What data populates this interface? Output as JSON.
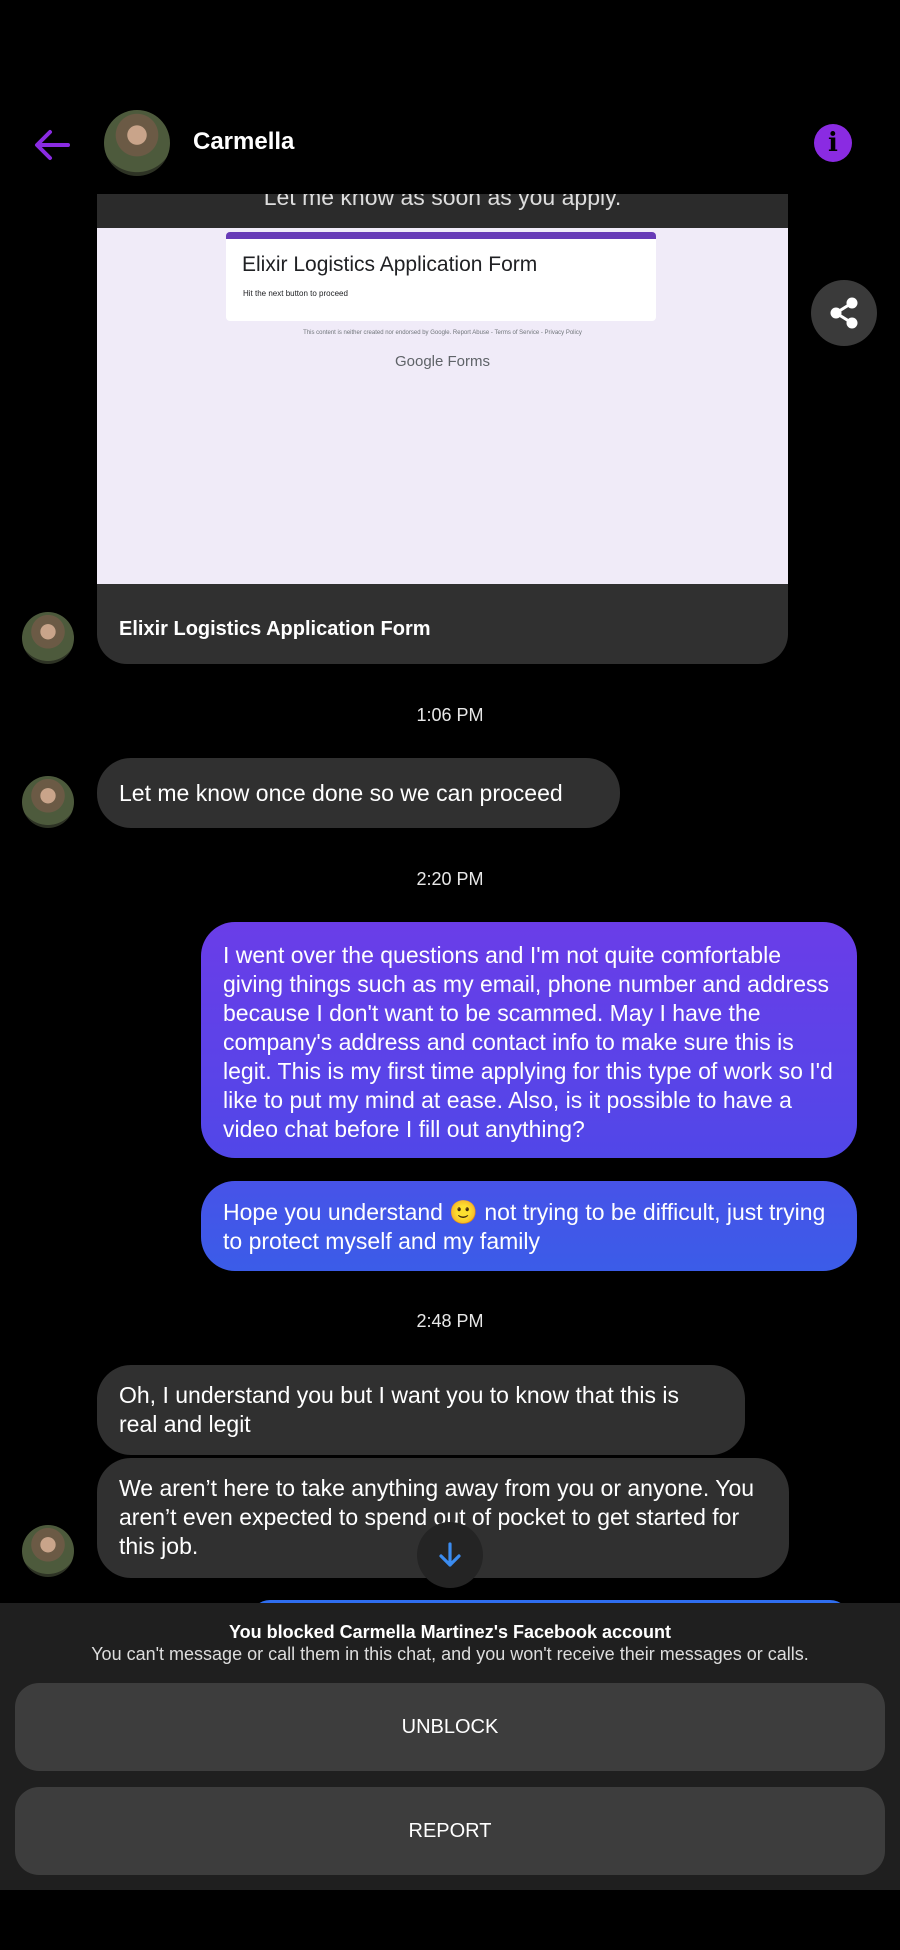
{
  "header": {
    "contact_name": "Carmella",
    "back_icon": "arrow-left-icon",
    "info_icon": "info-icon",
    "accent_color": "#8a2be2"
  },
  "link_card": {
    "caption": "Let me know as soon as you apply.",
    "preview": {
      "form_title": "Elixir Logistics Application Form",
      "form_subtitle": "Hit the next button to proceed",
      "disclaimer": "This content is neither created nor endorsed by Google. Report Abuse - Terms of Service - Privacy Policy",
      "brand_google": "Google",
      "brand_forms": "Forms"
    },
    "title": "Elixir Logistics Application Form"
  },
  "messages": {
    "ts1": "1:06 PM",
    "in1": "Let me know once done so we can proceed",
    "ts2": "2:20 PM",
    "out1": "I went over the questions and I'm not quite comfortable giving things such as my email, phone number and address because I don't want to be scammed. May I have the company's address and contact info to make sure this is legit. This is my first time applying for this type of work so I'd like to put my mind at ease. Also, is it possible to have a video chat before I fill out anything?",
    "out2_part1": "Hope you understand",
    "out2_emoji": "🙂",
    "out2_part2": "not trying to be difficult, just trying to protect myself and my family",
    "ts3": "2:48 PM",
    "in2": "Oh, I understand you but I want you to know that this is real and legit",
    "in3": "We aren’t here to take anything away from you or anyone. You aren’t even expected to spend out of pocket to get started for this job.",
    "outgoing_gradient": [
      "#6a3de8",
      "#3b5ce8"
    ]
  },
  "block_panel": {
    "title": "You blocked Carmella Martinez's Facebook account",
    "description": "You can't message or call them in this chat, and you won't receive their messages or calls.",
    "unblock_label": "UNBLOCK",
    "report_label": "REPORT"
  }
}
